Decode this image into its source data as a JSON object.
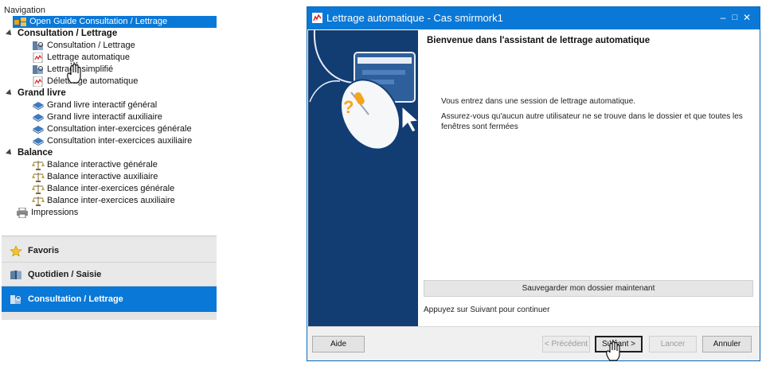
{
  "navigation": {
    "title": "Navigation",
    "selected_item": "Open Guide Consultation / Lettrage",
    "groups": [
      {
        "label": "Consultation / Lettrage",
        "items": [
          "Consultation / Lettrage",
          "Lettrage automatique",
          "Lettrage simplifié",
          "Délettrage automatique"
        ]
      },
      {
        "label": "Grand livre",
        "items": [
          "Grand livre interactif général",
          "Grand livre interactif auxiliaire",
          "Consultation inter-exercices générale",
          "Consultation inter-exercices auxiliaire"
        ]
      },
      {
        "label": "Balance",
        "items": [
          "Balance interactive générale",
          "Balance interactive auxiliaire",
          "Balance inter-exercices générale",
          "Balance inter-exercices auxiliaire"
        ]
      }
    ],
    "impressions_label": "Impressions"
  },
  "sections": {
    "favoris": "Favoris",
    "quotidien": "Quotidien / Saisie",
    "consultation": "Consultation / Lettrage"
  },
  "window": {
    "title": "Lettrage automatique - Cas smirmork1",
    "minimize": "–",
    "maximize": "□",
    "close": "✕"
  },
  "wizard": {
    "heading": "Bienvenue dans l'assistant de lettrage automatique",
    "paragraph1": "Vous entrez dans une session de lettrage automatique.",
    "paragraph2": "Assurez-vous qu'aucun autre utilisateur ne se trouve dans le dossier et que toutes les fenêtres sont fermées",
    "save_button": "Sauvegarder mon dossier maintenant",
    "hint": "Appuyez sur Suivant pour continuer"
  },
  "buttons": {
    "aide": "Aide",
    "precedent": "< Précédent",
    "suivant": "Suivant >",
    "lancer": "Lancer",
    "annuler": "Annuler"
  },
  "colors": {
    "accent": "#0a78d7",
    "side_panel": "#123d72"
  }
}
